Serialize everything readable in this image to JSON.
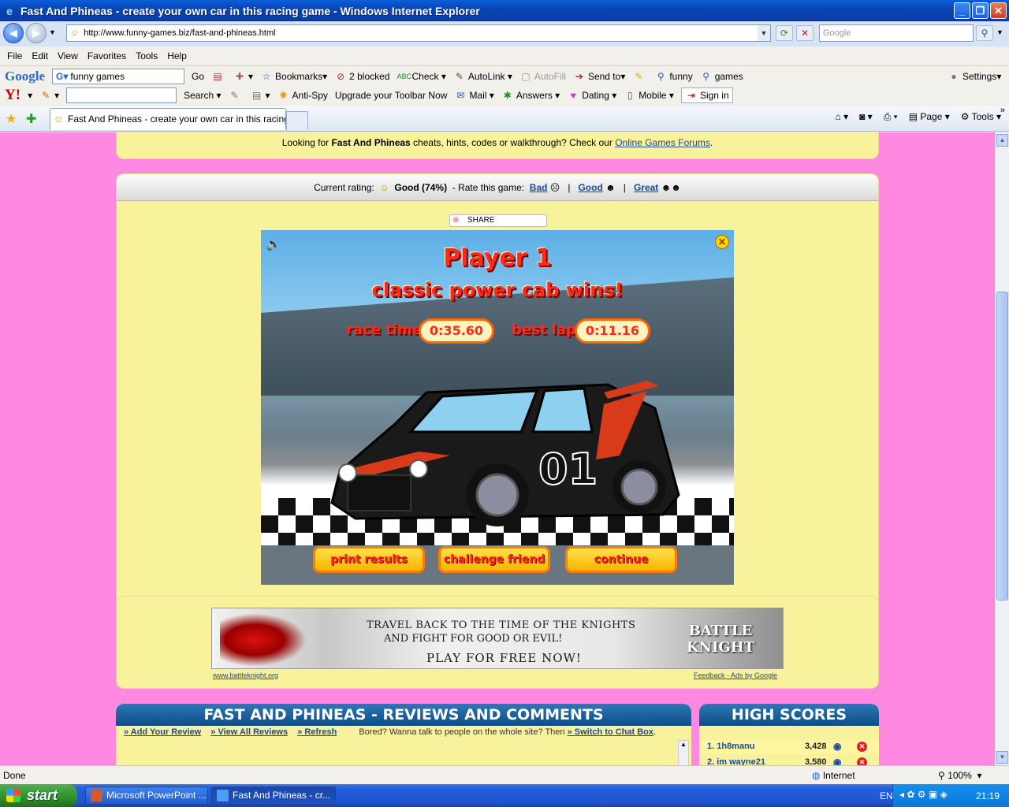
{
  "window": {
    "title": "Fast And Phineas - create your own car in this racing game - Windows Internet Explorer"
  },
  "address": {
    "url": "http://www.funny-games.biz/fast-and-phineas.html",
    "search_placeholder": "Google"
  },
  "menu": [
    "File",
    "Edit",
    "View",
    "Favorites",
    "Tools",
    "Help"
  ],
  "google_toolbar": {
    "logo": "Google",
    "search_value": "funny games",
    "go": "Go",
    "bookmarks": "Bookmarks",
    "blocked": "2 blocked",
    "check": "Check",
    "autolink": "AutoLink",
    "autofill": "AutoFill",
    "sendto": "Send to",
    "funny": "funny",
    "games": "games",
    "settings": "Settings"
  },
  "yahoo_toolbar": {
    "logo": "Y!",
    "search": "Search",
    "antispy": "Anti-Spy",
    "upgrade": "Upgrade your Toolbar Now",
    "mail": "Mail",
    "answers": "Answers",
    "dating": "Dating",
    "mobile": "Mobile",
    "signin": "Sign in"
  },
  "tabs": {
    "active_tab": "Fast And Phineas - create your own car in this racing ...",
    "cmd_page": "Page",
    "cmd_tools": "Tools"
  },
  "page": {
    "cheat_prefix": "Looking for ",
    "cheat_game": "Fast And Phineas",
    "cheat_middle": " cheats, hints, codes or walkthrough? Check our ",
    "cheat_link": "Online Games Forums",
    "cheat_suffix": ".",
    "rating_label": "Current rating:",
    "rating_value": "Good (74%)",
    "rate_label": "-  Rate this game:",
    "rate_bad": "Bad",
    "rate_good": "Good",
    "rate_great": "Great",
    "sep": "|",
    "share": "SHARE"
  },
  "game": {
    "player": "Player 1",
    "winner": "classic power cab wins!",
    "race_time_label": "race time",
    "race_time": "0:35.60",
    "best_lap_label": "best lap",
    "best_lap": "0:11.16",
    "car_number": "01",
    "btn_print": "print results",
    "btn_challenge": "challenge friend",
    "btn_continue": "continue"
  },
  "ad": {
    "line1": "TRAVEL BACK TO THE TIME OF THE KNIGHTS",
    "line2": "AND FIGHT FOR GOOD OR EVIL!",
    "line3": "PLAY FOR FREE NOW!",
    "brand": "BATTLE KNIGHT",
    "site": "www.battleknight.org",
    "feedback": "Feedback - Ads by Google"
  },
  "reviews": {
    "title": "FAST AND PHINEAS - REVIEWS AND COMMENTS",
    "add": "» Add Your Review",
    "view": "» View All Reviews",
    "refresh": "» Refresh",
    "bored": "Bored? Wanna talk to people on the whole site? Then ",
    "chat": "» Switch to Chat Box",
    "chat_suffix": "."
  },
  "scores": {
    "title": "HIGH SCORES",
    "rows": [
      {
        "name": "1. 1h8manu",
        "score": "3,428"
      },
      {
        "name": "2. im wayne21",
        "score": "3,580"
      }
    ]
  },
  "status": {
    "text": "Done",
    "zone": "Internet",
    "zoom": "100%"
  },
  "taskbar": {
    "start": "start",
    "task1": "Microsoft PowerPoint ...",
    "task2": "Fast And Phineas - cr...",
    "lang": "EN",
    "clock": "21:19"
  }
}
